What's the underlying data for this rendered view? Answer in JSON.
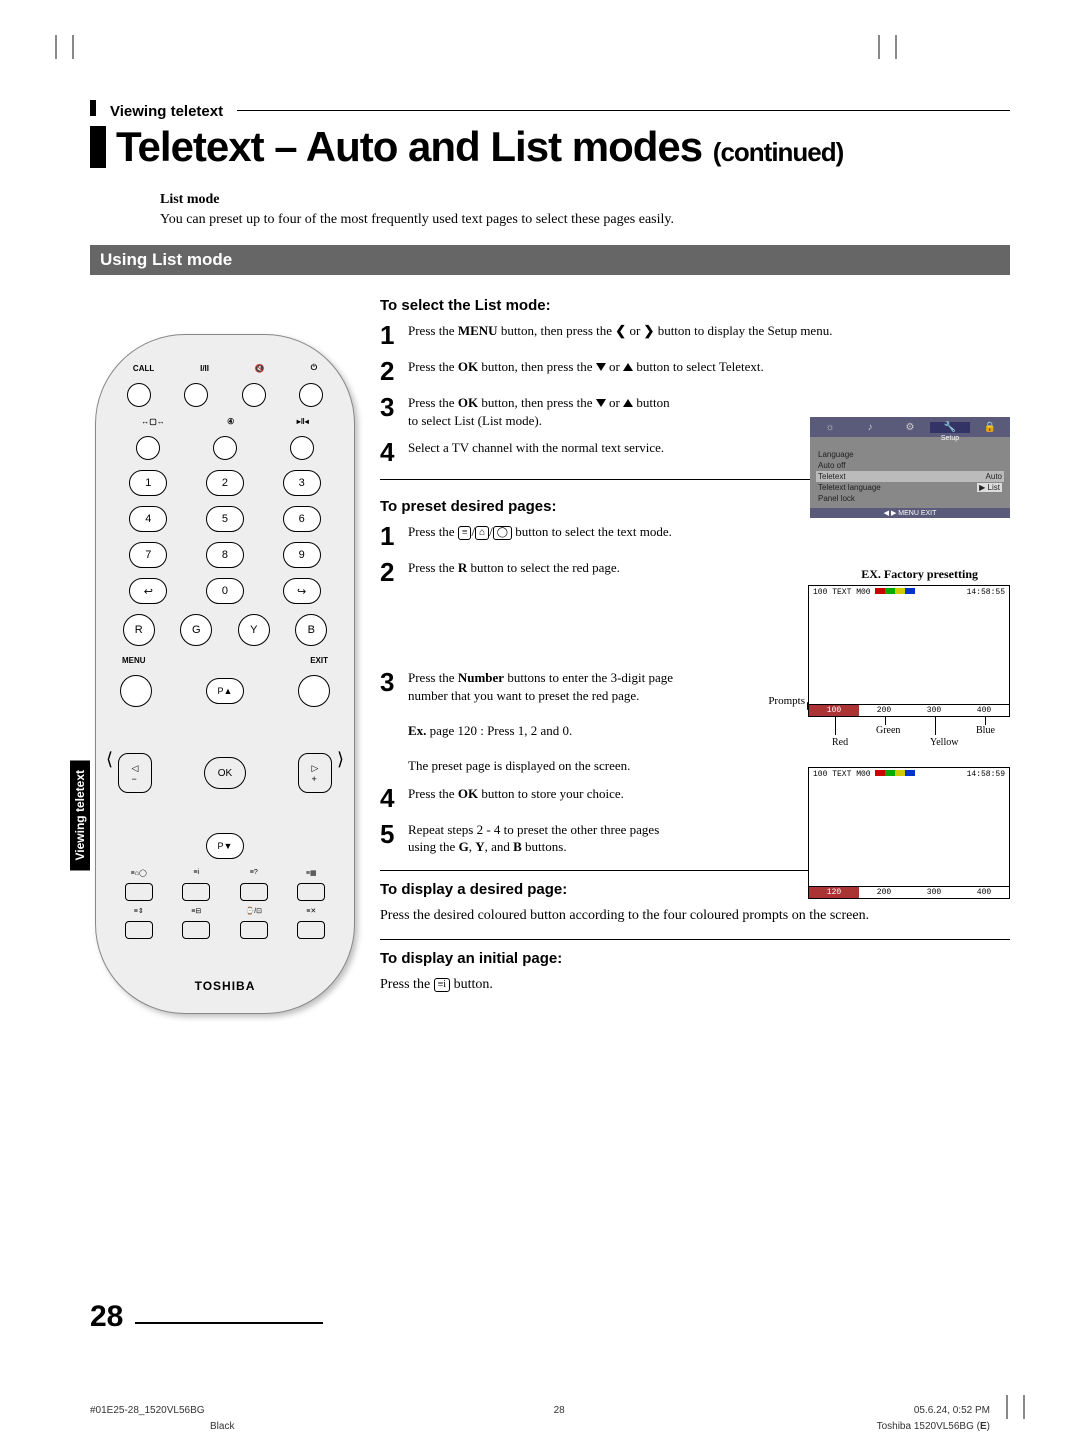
{
  "breadcrumb": "Viewing teletext",
  "title_main": "Teletext – Auto and List modes",
  "title_cont": "(continued)",
  "intro_heading": "List mode",
  "intro_text": "You can preset up to four of the most frequently used text pages to select these pages easily.",
  "section_title": "Using List mode",
  "side_tab": "Viewing teletext",
  "remote": {
    "top_labels": {
      "call": "CALL",
      "audio": "I/II"
    },
    "numbers": [
      "1",
      "2",
      "3",
      "4",
      "5",
      "6",
      "7",
      "8",
      "9",
      "0"
    ],
    "color_letters": [
      "R",
      "G",
      "Y",
      "B"
    ],
    "menu": "MENU",
    "exit": "EXIT",
    "ok": "OK",
    "p_up": "P▲",
    "p_down": "P▼",
    "brand": "TOSHIBA"
  },
  "sub_select": "To select the List mode:",
  "steps_select": [
    "Press the MENU button, then press the ❮ or ❯ button to display the Setup menu.",
    "Press the OK button, then press the ▼ or ▲ button to select Teletext.",
    "Press the OK button, then press the ▼ or ▲ button to select List (List mode).",
    "Select a TV channel with the normal text service."
  ],
  "sub_preset": "To preset desired pages:",
  "ex_factory": "EX. Factory presetting",
  "steps_preset": [
    "Press the ≡/⌂/◯ button to select the text mode.",
    "Press the R button to select the red page.",
    "Press the Number buttons to enter the 3-digit page number that you want to preset the red page.",
    "Press the OK button to store your choice.",
    "Repeat steps 2 - 4 to preset the other three pages using the G, Y, and B buttons."
  ],
  "preset_ex_label": "Ex.",
  "preset_ex_text": " page 120 : Press 1, 2 and 0.",
  "preset_result": "The preset page is displayed on the screen.",
  "prompts_label": "Prompts",
  "color_names": {
    "red": "Red",
    "green": "Green",
    "yellow": "Yellow",
    "blue": "Blue"
  },
  "sub_display": "To display a desired page:",
  "display_text": "Press the desired coloured button according to the four coloured prompts on the screen.",
  "sub_initial": "To display an initial page:",
  "initial_text_pre": "Press the ",
  "initial_text_post": " button.",
  "setup_menu": {
    "tabs_icons": [
      "☼",
      "♪",
      "⚙",
      "🔧",
      "🔒"
    ],
    "selected_tab_label": "Setup",
    "rows": [
      {
        "k": "Language",
        "v": ""
      },
      {
        "k": "Auto off",
        "v": ""
      },
      {
        "k": "Teletext",
        "v": "Auto"
      },
      {
        "k": "Teletext language",
        "v": "▶ List"
      },
      {
        "k": "Panel lock",
        "v": ""
      }
    ],
    "foot": "◀ ▶ MENU EXIT"
  },
  "ttx1": {
    "hdr_left": "100  TEXT  M00",
    "hdr_right": "14:58:55",
    "prompts": [
      "100",
      "200",
      "300",
      "400"
    ]
  },
  "ttx2": {
    "hdr_left": "100  TEXT  M00",
    "hdr_right": "14:58:59",
    "prompts": [
      "120",
      "200",
      "300",
      "400"
    ]
  },
  "page_number": "28",
  "footer": {
    "left": "#01E25-28_1520VL56BG",
    "center": "28",
    "right": "05.6.24, 0:52 PM",
    "black": "Black",
    "model": "Toshiba 1520VL56BG (E)"
  }
}
